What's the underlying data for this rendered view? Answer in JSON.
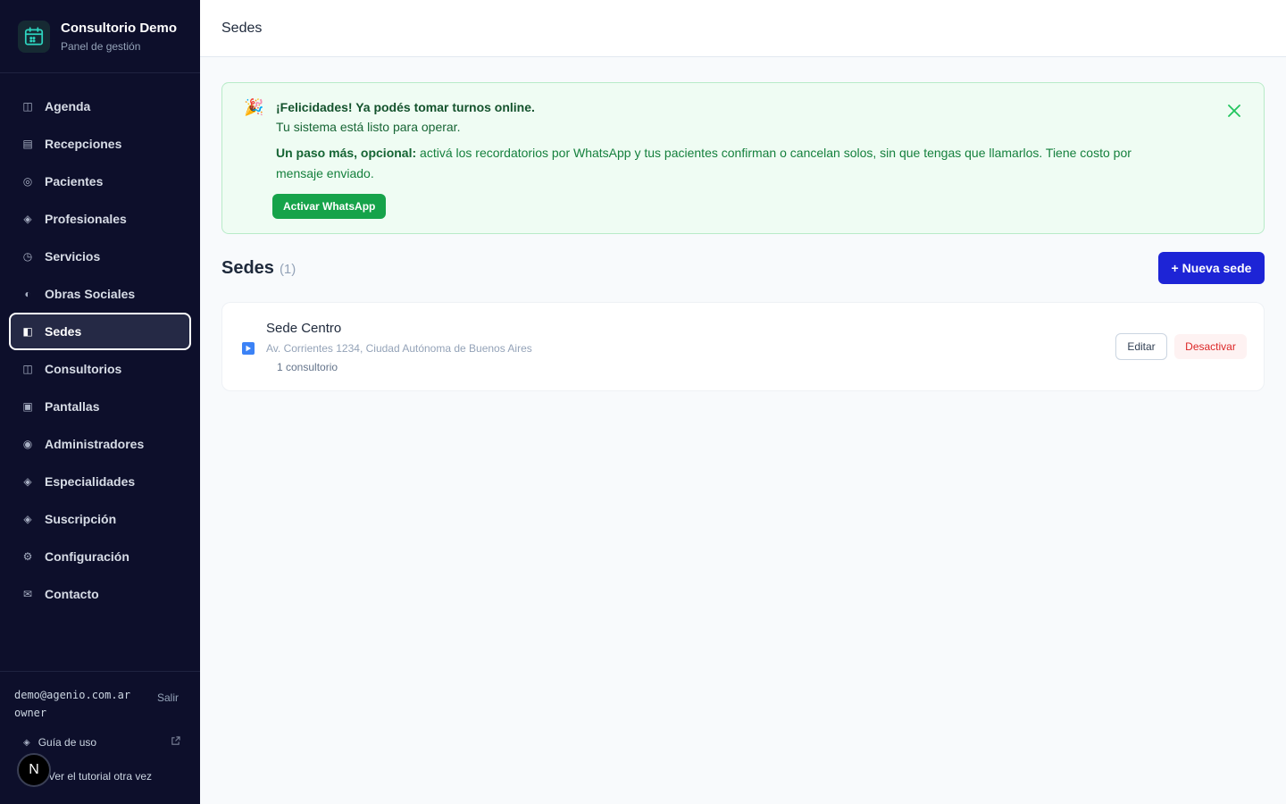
{
  "brand": {
    "title": "Consultorio Demo",
    "subtitle": "Panel de gestión"
  },
  "nav": {
    "items": [
      {
        "label": "Agenda",
        "icon": "columns-icon",
        "glyph": "◫"
      },
      {
        "label": "Recepciones",
        "icon": "list-icon",
        "glyph": "▤"
      },
      {
        "label": "Pacientes",
        "icon": "target-icon",
        "glyph": "◎"
      },
      {
        "label": "Profesionales",
        "icon": "diamond-icon",
        "glyph": "◈"
      },
      {
        "label": "Servicios",
        "icon": "clock-icon",
        "glyph": "◷"
      },
      {
        "label": "Obras Sociales",
        "icon": "half-circle-icon",
        "glyph": "◐"
      },
      {
        "label": "Sedes",
        "icon": "panel-icon",
        "glyph": "◧",
        "active": true
      },
      {
        "label": "Consultorios",
        "icon": "columns-icon",
        "glyph": "◫"
      },
      {
        "label": "Pantallas",
        "icon": "screen-icon",
        "glyph": "▣"
      },
      {
        "label": "Administradores",
        "icon": "dot-circle-icon",
        "glyph": "◉"
      },
      {
        "label": "Especialidades",
        "icon": "diamond-icon",
        "glyph": "◈"
      },
      {
        "label": "Suscripción",
        "icon": "diamond-icon",
        "glyph": "◈"
      },
      {
        "label": "Configuración",
        "icon": "gear-icon",
        "glyph": "⚙"
      },
      {
        "label": "Contacto",
        "icon": "mail-icon",
        "glyph": "✉"
      }
    ]
  },
  "footer": {
    "email": "demo@agenio.com.ar",
    "role": "owner",
    "logout": "Salir",
    "guide": "Guía de uso",
    "tutorial": "Ver el tutorial otra vez",
    "badge": "N"
  },
  "topbar": {
    "title": "Sedes"
  },
  "banner": {
    "emoji": "🎉",
    "title": "¡Felicidades! Ya podés tomar turnos online.",
    "subtitle": "Tu sistema está listo para operar.",
    "lead": "Un paso más, opcional:",
    "text": " activá los recordatorios por WhatsApp y tus pacientes confirman o cancelan solos, sin que tengas que llamarlos. Tiene costo por mensaje enviado.",
    "button": "Activar WhatsApp"
  },
  "section": {
    "title": "Sedes",
    "count": "(1)",
    "new_button": "+ Nueva sede"
  },
  "sedes": [
    {
      "name": "Sede Centro",
      "address": "Av. Corrientes 1234, Ciudad Autónoma de Buenos Aires",
      "count": "1 consultorio",
      "edit": "Editar",
      "deactivate": "Desactivar"
    }
  ],
  "colors": {
    "sidebar": "#0d0f2b",
    "accent": "#1d24d6",
    "success": "#16a34a",
    "danger": "#dc2626"
  }
}
